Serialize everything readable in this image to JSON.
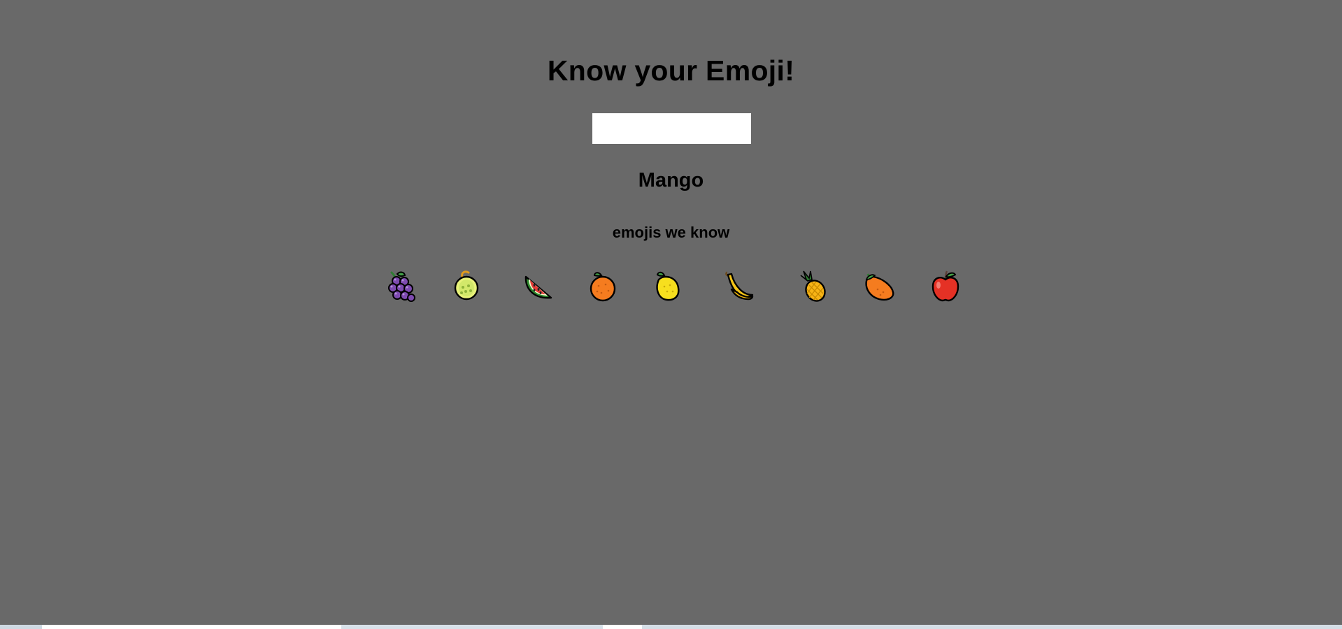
{
  "page": {
    "title": "Know your Emoji!",
    "search": {
      "value": "",
      "placeholder": ""
    },
    "meaning": "Mango",
    "subheading": "emojis we know"
  },
  "emojis": [
    {
      "char": "🍇",
      "icon": "grapes-icon"
    },
    {
      "char": "🍈",
      "icon": "melon-icon"
    },
    {
      "char": "🍉",
      "icon": "watermelon-icon"
    },
    {
      "char": "🍊",
      "icon": "tangerine-icon"
    },
    {
      "char": "🍋",
      "icon": "lemon-icon"
    },
    {
      "char": "🍌",
      "icon": "banana-icon"
    },
    {
      "char": "🍍",
      "icon": "pineapple-icon"
    },
    {
      "char": "🥭",
      "icon": "mango-icon"
    },
    {
      "char": "🍎",
      "icon": "red-apple-icon"
    }
  ],
  "colors": {
    "background": "#696969",
    "text": "#000000",
    "input_bg": "#ffffff"
  }
}
